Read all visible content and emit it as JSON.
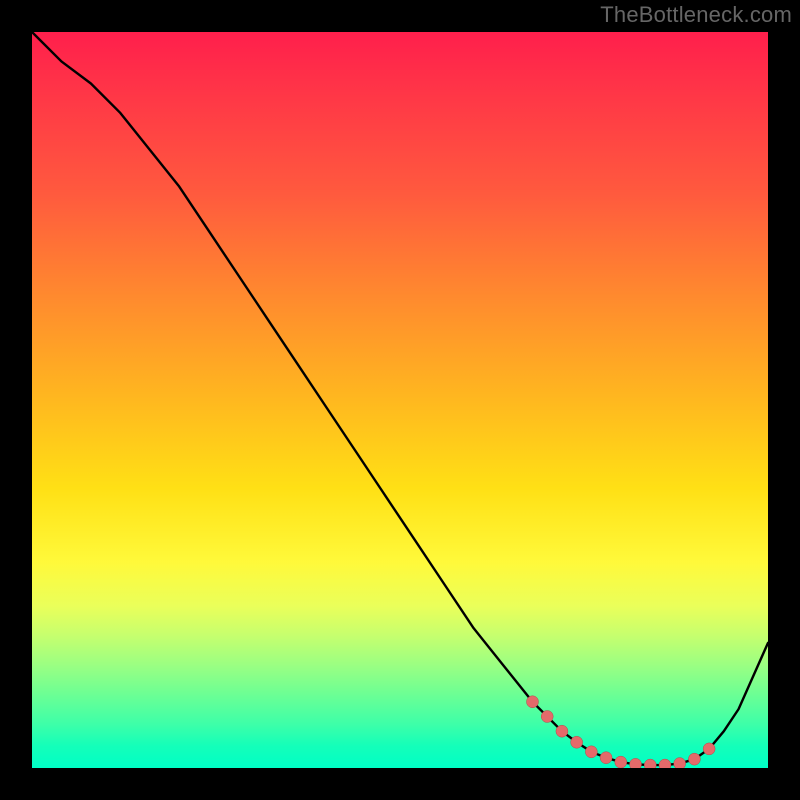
{
  "watermark": "TheBottleneck.com",
  "chart_data": {
    "type": "line",
    "title": "",
    "xlabel": "",
    "ylabel": "",
    "xlim": [
      0,
      100
    ],
    "ylim": [
      0,
      100
    ],
    "series": [
      {
        "name": "curve",
        "x": [
          0,
          4,
          8,
          12,
          16,
          20,
          24,
          28,
          32,
          36,
          40,
          44,
          48,
          52,
          56,
          60,
          64,
          68,
          70,
          72,
          74,
          76,
          78,
          80,
          82,
          84,
          86,
          88,
          90,
          92,
          94,
          96,
          100
        ],
        "values": [
          100,
          96,
          93,
          89,
          84,
          79,
          73,
          67,
          61,
          55,
          49,
          43,
          37,
          31,
          25,
          19,
          14,
          9,
          7,
          5,
          3.5,
          2.2,
          1.4,
          0.8,
          0.5,
          0.4,
          0.4,
          0.6,
          1.2,
          2.6,
          5,
          8,
          17
        ]
      }
    ],
    "markers": {
      "name": "dots",
      "x": [
        68,
        70,
        72,
        74,
        76,
        78,
        80,
        82,
        84,
        86,
        88,
        90,
        92
      ],
      "values": [
        9,
        7,
        5,
        3.5,
        2.2,
        1.4,
        0.8,
        0.5,
        0.4,
        0.4,
        0.6,
        1.2,
        2.6
      ],
      "color": "#e46a6a",
      "radius": 6
    },
    "background": {
      "type": "vertical-gradient",
      "stops": [
        {
          "pos": 0.0,
          "color": "#ff1f4c"
        },
        {
          "pos": 0.5,
          "color": "#ffb81f"
        },
        {
          "pos": 0.72,
          "color": "#fff93a"
        },
        {
          "pos": 1.0,
          "color": "#00ffc6"
        }
      ]
    }
  }
}
